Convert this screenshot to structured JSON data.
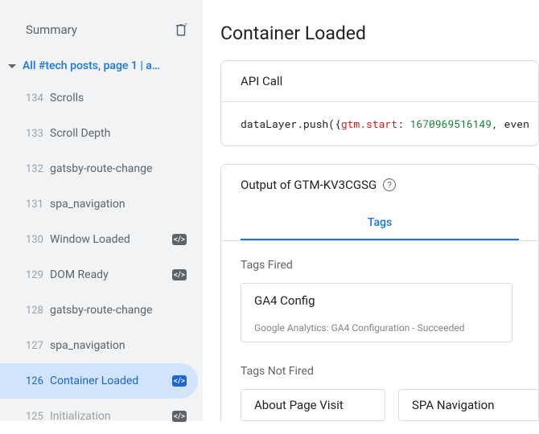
{
  "sidebar": {
    "title": "Summary",
    "group_title": "All #tech posts, page 1 | a…",
    "events": [
      {
        "num": "134",
        "label": "Scrolls",
        "badge": null,
        "selected": false
      },
      {
        "num": "133",
        "label": "Scroll Depth",
        "badge": null,
        "selected": false
      },
      {
        "num": "132",
        "label": "gatsby-route-change",
        "badge": null,
        "selected": false
      },
      {
        "num": "131",
        "label": "spa_navigation",
        "badge": null,
        "selected": false
      },
      {
        "num": "130",
        "label": "Window Loaded",
        "badge": "</>",
        "selected": false
      },
      {
        "num": "129",
        "label": "DOM Ready",
        "badge": "</>",
        "selected": false
      },
      {
        "num": "128",
        "label": "gatsby-route-change",
        "badge": null,
        "selected": false
      },
      {
        "num": "127",
        "label": "spa_navigation",
        "badge": null,
        "selected": false
      },
      {
        "num": "126",
        "label": "Container Loaded",
        "badge": "</>",
        "selected": true
      },
      {
        "num": "125",
        "label": "Initialization",
        "badge": "</>",
        "selected": false,
        "faded": true
      }
    ]
  },
  "main": {
    "title": "Container Loaded",
    "api_call": {
      "heading": "API Call",
      "code_fn": "dataLayer.push",
      "code_key": "gtm.start",
      "code_num": "1670969516149",
      "code_trail": ", even"
    },
    "output": {
      "heading_pre": "Output of ",
      "heading_id": "GTM-KV3CGSG",
      "tabs": [
        {
          "label": "Tags",
          "active": true
        }
      ],
      "fired_label": "Tags Fired",
      "fired_tag": {
        "name": "GA4 Config",
        "meta": "Google Analytics: GA4 Configuration - Succeeded"
      },
      "not_fired_label": "Tags Not Fired",
      "not_fired_tags": [
        {
          "name": "About Page Visit"
        },
        {
          "name": "SPA Navigation"
        }
      ]
    }
  }
}
